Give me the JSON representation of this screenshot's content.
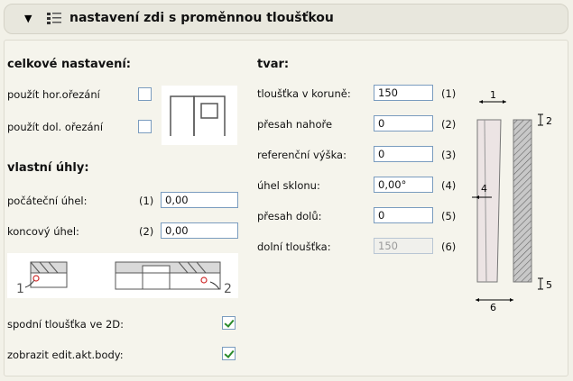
{
  "header": {
    "title": "nastavení zdi s proměnnou tloušťkou"
  },
  "general": {
    "heading": "celkové nastavení:",
    "top_trim_label": "použít hor.ořezání",
    "bottom_trim_label": "použít dol. ořezání",
    "top_trim_checked": false,
    "bottom_trim_checked": false
  },
  "angles": {
    "heading": "vlastní úhly:",
    "start_label": "počáteční úhel:",
    "start_idx": "(1)",
    "start_value": "0,00",
    "end_label": "koncový úhel:",
    "end_idx": "(2)",
    "end_value": "0,00",
    "illus_num1": "1",
    "illus_num2": "2"
  },
  "options": {
    "bottom_thickness_2d_label": "spodní tloušťka ve 2D:",
    "bottom_thickness_2d_checked": true,
    "show_hotspots_label": "zobrazit edit.akt.body:",
    "show_hotspots_checked": true
  },
  "shape": {
    "heading": "tvar:",
    "fields": [
      {
        "label": "tloušťka v koruně:",
        "value": "150",
        "idx": "(1)",
        "disabled": false
      },
      {
        "label": "přesah nahoře",
        "value": "0",
        "idx": "(2)",
        "disabled": false
      },
      {
        "label": "referenční výška:",
        "value": "0",
        "idx": "(3)",
        "disabled": false
      },
      {
        "label": "úhel sklonu:",
        "value": "0,00°",
        "idx": "(4)",
        "disabled": false
      },
      {
        "label": "přesah dolů:",
        "value": "0",
        "idx": "(5)",
        "disabled": false
      },
      {
        "label": "dolní tloušťka:",
        "value": "150",
        "idx": "(6)",
        "disabled": true
      }
    ]
  },
  "diagram": {
    "d1": "1",
    "d2": "2",
    "d4": "4",
    "d5": "5",
    "d6": "6"
  },
  "colors": {
    "accent_check": "#2a8a2a",
    "input_border": "#7a9cbf",
    "panel_bg": "#f5f4ec"
  }
}
